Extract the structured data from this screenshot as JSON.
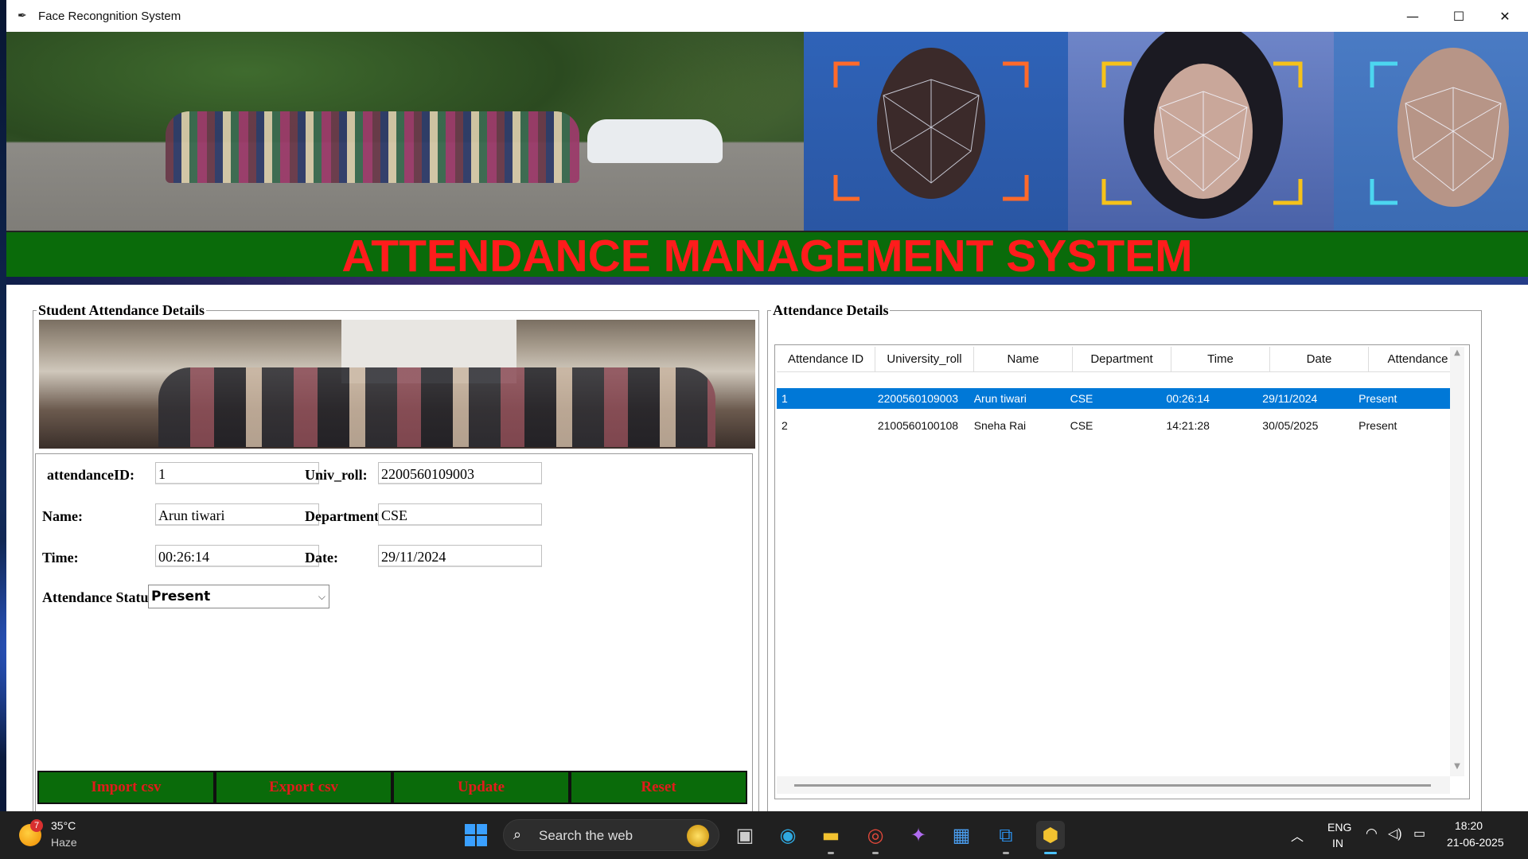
{
  "window": {
    "title": "Face Recongnition System",
    "controls": {
      "minimize": "—",
      "maximize": "☐",
      "close": "✕"
    }
  },
  "banner": {
    "heading": "ATTENDANCE MANAGEMENT SYSTEM",
    "heading_color": "#ff1c1c",
    "bar_color": "#0a6b0a"
  },
  "left_panel": {
    "title": "Student Attendance Details",
    "fields": {
      "attendance_id_label": "attendanceID:",
      "attendance_id_value": "1",
      "univ_roll_label": "Univ_roll:",
      "univ_roll_value": "2200560109003",
      "name_label": "Name:",
      "name_value": "Arun tiwari",
      "department_label": "Department:",
      "department_value": "CSE",
      "time_label": "Time:",
      "time_value": "00:26:14",
      "date_label": "Date:",
      "date_value": "29/11/2024",
      "status_label": "Attendance Status:",
      "status_value": "Present"
    },
    "buttons": {
      "import": "Import csv",
      "export": "Export csv",
      "update": "Update",
      "reset": "Reset"
    }
  },
  "right_panel": {
    "title": "Attendance Details",
    "columns": [
      "Attendance ID",
      "University_roll",
      "Name",
      "Department",
      "Time",
      "Date",
      "Attendance"
    ],
    "rows": [
      [
        "1",
        "2200560109003",
        "Arun tiwari",
        "CSE",
        "00:26:14",
        "29/11/2024",
        "Present"
      ],
      [
        "2",
        "2100560100108",
        "Sneha Rai",
        "CSE",
        "14:21:28",
        "30/05/2025",
        "Present"
      ]
    ],
    "selected_row": 0,
    "selection_color": "#0078d7"
  },
  "taskbar": {
    "weather_temp": "35°C",
    "weather_desc": "Haze",
    "weather_badge": "7",
    "search_placeholder": "Search the web",
    "apps": [
      "task-view",
      "edge",
      "file-explorer",
      "chrome",
      "copilot",
      "store",
      "vscode",
      "python"
    ],
    "lang_primary": "ENG",
    "lang_secondary": "IN",
    "time": "18:20",
    "date": "21-06-2025"
  }
}
